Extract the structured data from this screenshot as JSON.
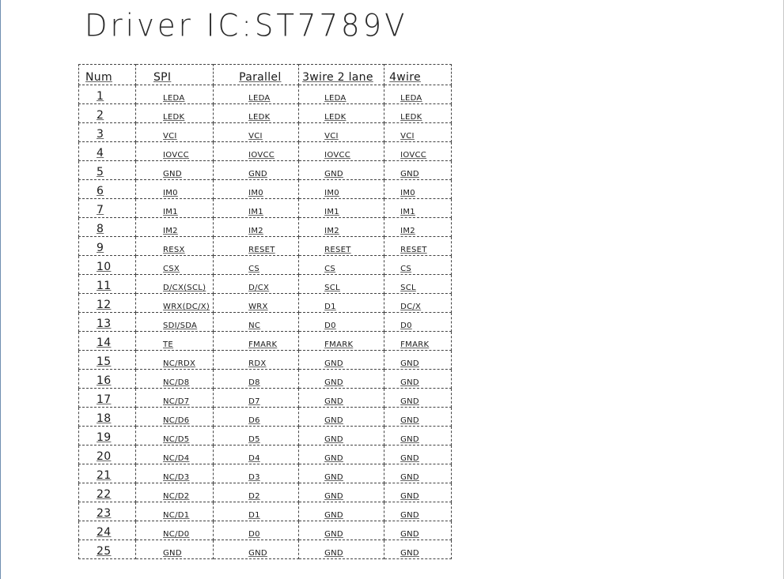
{
  "document": {
    "title": "Driver IC:ST7789V",
    "table": {
      "headers": [
        "Num",
        "SPI",
        "Parallel",
        "3wire 2 lane",
        "4wire"
      ],
      "rows": [
        [
          "1",
          "LEDA",
          "LEDA",
          "LEDA",
          "LEDA"
        ],
        [
          "2",
          "LEDK",
          "LEDK",
          "LEDK",
          "LEDK"
        ],
        [
          "3",
          "VCI",
          "VCI",
          "VCI",
          "VCI"
        ],
        [
          "4",
          "IOVCC",
          "IOVCC",
          "IOVCC",
          "IOVCC"
        ],
        [
          "5",
          "GND",
          "GND",
          "GND",
          "GND"
        ],
        [
          "6",
          "IM0",
          "IM0",
          "IM0",
          "IM0"
        ],
        [
          "7",
          "IM1",
          "IM1",
          "IM1",
          "IM1"
        ],
        [
          "8",
          "IM2",
          "IM2",
          "IM2",
          "IM2"
        ],
        [
          "9",
          "RESX",
          "RESET",
          "RESET",
          "RESET"
        ],
        [
          "10",
          "CSX",
          "CS",
          "CS",
          "CS"
        ],
        [
          "11",
          "D/CX(SCL)",
          "D/CX",
          "SCL",
          "SCL"
        ],
        [
          "12",
          "WRX(DC/X)",
          "WRX",
          "D1",
          "DC/X"
        ],
        [
          "13",
          "SDI/SDA",
          "NC",
          "D0",
          "D0"
        ],
        [
          "14",
          "TE",
          "FMARK",
          "FMARK",
          "FMARK"
        ],
        [
          "15",
          "NC/RDX",
          "RDX",
          "GND",
          "GND"
        ],
        [
          "16",
          "NC/D8",
          "D8",
          "GND",
          "GND"
        ],
        [
          "17",
          "NC/D7",
          "D7",
          "GND",
          "GND"
        ],
        [
          "18",
          "NC/D6",
          "D6",
          "GND",
          "GND"
        ],
        [
          "19",
          "NC/D5",
          "D5",
          "GND",
          "GND"
        ],
        [
          "20",
          "NC/D4",
          "D4",
          "GND",
          "GND"
        ],
        [
          "21",
          "NC/D3",
          "D3",
          "GND",
          "GND"
        ],
        [
          "22",
          "NC/D2",
          "D2",
          "GND",
          "GND"
        ],
        [
          "23",
          "NC/D1",
          "D1",
          "GND",
          "GND"
        ],
        [
          "24",
          "NC/D0",
          "D0",
          "GND",
          "GND"
        ],
        [
          "25",
          "GND",
          "GND",
          "GND",
          "GND"
        ]
      ]
    }
  }
}
